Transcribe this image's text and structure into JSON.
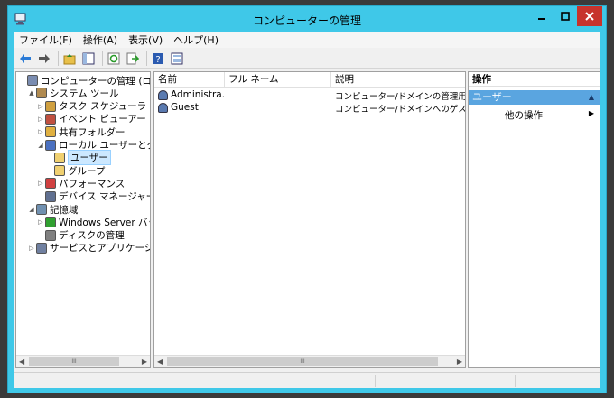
{
  "window": {
    "title": "コンピューターの管理"
  },
  "menu": [
    "ファイル(F)",
    "操作(A)",
    "表示(V)",
    "ヘルプ(H)"
  ],
  "toolbar_icons": [
    "back-arrow-icon",
    "forward-arrow-icon",
    "up-folder-icon",
    "show-tree-icon",
    "refresh-icon",
    "export-icon",
    "help-icon",
    "properties-icon"
  ],
  "tree": [
    {
      "label": "コンピューターの管理 (ローカル)",
      "level": 0,
      "expander": "",
      "icon": "computer-management-icon"
    },
    {
      "label": "システム ツール",
      "level": 1,
      "expander": "▲",
      "icon": "system-tools-icon"
    },
    {
      "label": "タスク スケジューラ",
      "level": 2,
      "expander": "▷",
      "icon": "task-scheduler-icon"
    },
    {
      "label": "イベント ビューアー",
      "level": 2,
      "expander": "▷",
      "icon": "event-viewer-icon"
    },
    {
      "label": "共有フォルダー",
      "level": 2,
      "expander": "▷",
      "icon": "shared-folders-icon"
    },
    {
      "label": "ローカル ユーザーとグループ",
      "level": 2,
      "expander": "◢",
      "icon": "local-users-groups-icon"
    },
    {
      "label": "ユーザー",
      "level": 3,
      "expander": "",
      "icon": "folder-icon",
      "selected": true
    },
    {
      "label": "グループ",
      "level": 3,
      "expander": "",
      "icon": "folder-icon"
    },
    {
      "label": "パフォーマンス",
      "level": 2,
      "expander": "▷",
      "icon": "performance-icon"
    },
    {
      "label": "デバイス マネージャー",
      "level": 2,
      "expander": "",
      "icon": "device-manager-icon"
    },
    {
      "label": "記憶域",
      "level": 1,
      "expander": "◢",
      "icon": "storage-icon"
    },
    {
      "label": "Windows Server バックアップ",
      "level": 2,
      "expander": "▷",
      "icon": "windows-server-backup-icon"
    },
    {
      "label": "ディスクの管理",
      "level": 2,
      "expander": "",
      "icon": "disk-management-icon"
    },
    {
      "label": "サービスとアプリケーション",
      "level": 1,
      "expander": "▷",
      "icon": "services-applications-icon"
    }
  ],
  "list": {
    "columns": [
      "名前",
      "フル ネーム",
      "説明"
    ],
    "rows": [
      {
        "name": "Administra...",
        "full_name": "",
        "description": "コンピューター/ドメインの管理用 (ビル..."
      },
      {
        "name": "Guest",
        "full_name": "",
        "description": "コンピューター/ドメインへのゲスト アク..."
      }
    ]
  },
  "actions": {
    "header": "操作",
    "section": "ユーザー",
    "items": [
      "他の操作"
    ]
  },
  "scrollbar_thumb_glyph": "III",
  "colors": {
    "titlebar": "#3fc8e8",
    "close": "#c7332c",
    "selection": "#cce8ff",
    "action_section": "#5aa5e0"
  }
}
